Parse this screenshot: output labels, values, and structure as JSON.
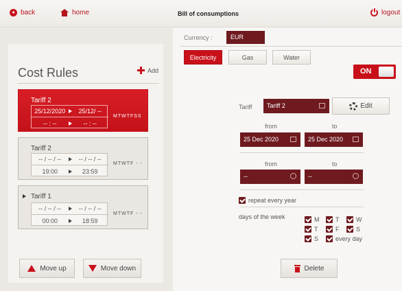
{
  "header": {
    "back_label": "back",
    "home_label": "home",
    "title": "Bill of consumptions",
    "logout_label": "logout"
  },
  "currency": {
    "label": "Currency :",
    "value": "EUR"
  },
  "tabs": [
    {
      "label": "Electricity",
      "active": true
    },
    {
      "label": "Gas",
      "active": false
    },
    {
      "label": "Water",
      "active": false
    }
  ],
  "toggle": {
    "label": "ON",
    "state": true
  },
  "cost_rules": {
    "title": "Cost Rules",
    "add_label": "Add",
    "tariffs": [
      {
        "name": "Tariff 2",
        "date_from": "25/12/2020",
        "date_to": "25/12/ --",
        "time_from": "-- : --",
        "time_to": "-- : --",
        "days": "MTWTFSS",
        "active": true
      },
      {
        "name": "Tariff 2",
        "date_from": "-- / -- / --",
        "date_to": "-- / -- / --",
        "time_from": "19:00",
        "time_to": "23:59",
        "days": "MTWTF - -",
        "active": false
      },
      {
        "name": "Tariff 1",
        "date_from": "-- / -- / --",
        "date_to": "-- / -- / --",
        "time_from": "00:00",
        "time_to": "18:59",
        "days": "MTWTF - -",
        "active": false,
        "selected": true
      }
    ]
  },
  "buttons": {
    "move_up": "Move up",
    "move_down": "Move down",
    "delete": "Delete",
    "edit": "Edit"
  },
  "editor": {
    "tariff_label": "Tariff",
    "tariff_value": "Tariff 2",
    "date_from_label": "from",
    "date_to_label": "to",
    "date_from": "25 Dec 2020",
    "date_to": "25 Dec 2020",
    "time_from_label": "from",
    "time_to_label": "to",
    "time_from": "--",
    "time_to": "--",
    "repeat_label": "repeat every year",
    "days_label": "days of the week",
    "days": [
      {
        "label": "M",
        "checked": true
      },
      {
        "label": "T",
        "checked": true
      },
      {
        "label": "W",
        "checked": true
      },
      {
        "label": "T",
        "checked": true
      },
      {
        "label": "F",
        "checked": true
      },
      {
        "label": "S",
        "checked": true
      },
      {
        "label": "S",
        "checked": true
      },
      {
        "label": "every day",
        "checked": true
      }
    ]
  },
  "colors": {
    "accent": "#c8101b",
    "dark_field": "#6e1a1f",
    "background": "#ece9e4"
  }
}
